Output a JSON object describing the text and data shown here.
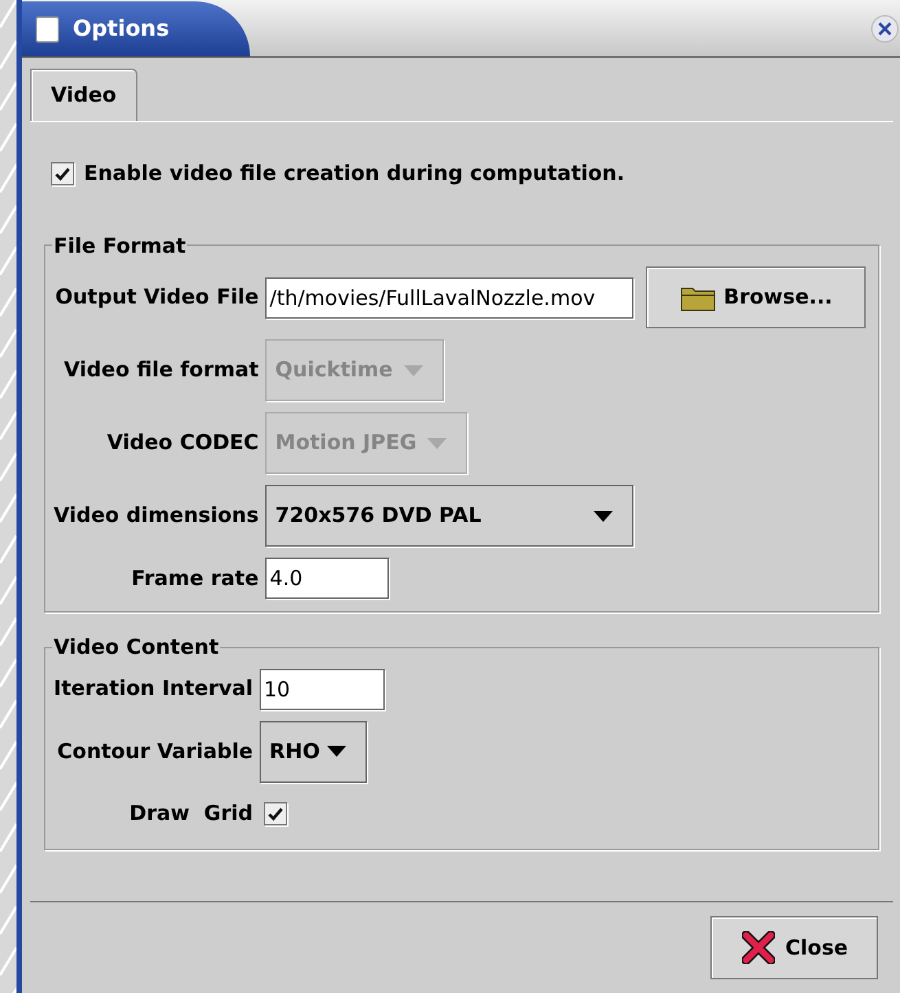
{
  "window": {
    "title": "Options"
  },
  "tabs": [
    {
      "label": "Video",
      "selected": true
    }
  ],
  "enable_option": {
    "label": "Enable video file creation during computation.",
    "checked": true
  },
  "file_format": {
    "title": "File Format",
    "fields": [
      {
        "kind": "text",
        "label": "Output Video File",
        "value": "/th/movies/FullLavalNozzle.mov",
        "button": "Browse..."
      },
      {
        "kind": "combo",
        "label": "Video file format",
        "value": "Quicktime",
        "disabled": true
      },
      {
        "kind": "combo",
        "label": "Video CODEC",
        "value": "Motion JPEG",
        "disabled": true
      },
      {
        "kind": "combo",
        "label": "Video dimensions",
        "value": "720x576 DVD PAL",
        "disabled": false
      },
      {
        "kind": "text",
        "label": "Frame rate",
        "value": "4.0"
      }
    ]
  },
  "video_content": {
    "title": "Video Content",
    "fields": [
      {
        "kind": "text",
        "label": "Iteration Interval",
        "value": "10"
      },
      {
        "kind": "combo",
        "label": "Contour Variable",
        "value": "RHO",
        "disabled": false
      },
      {
        "kind": "checkbox",
        "label": "Draw  Grid",
        "checked": true
      }
    ]
  },
  "close_button": "Close"
}
